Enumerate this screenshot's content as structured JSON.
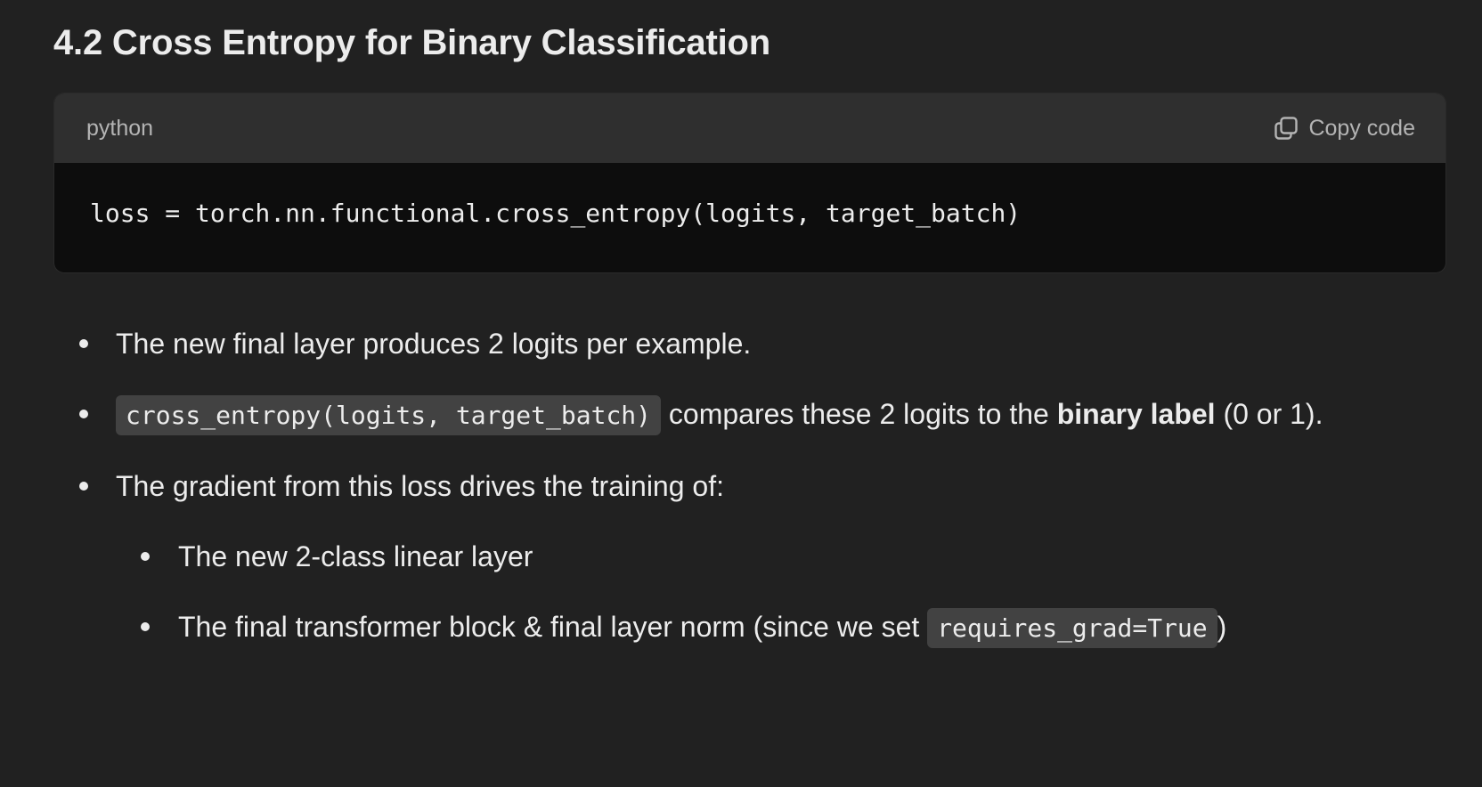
{
  "section": {
    "heading": "4.2 Cross Entropy for Binary Classification"
  },
  "code_block": {
    "language": "python",
    "copy_label": "Copy code",
    "copy_icon": "copy-icon",
    "code": "loss = torch.nn.functional.cross_entropy(logits, target_batch)"
  },
  "bullets": {
    "item1": "The new final layer produces 2 logits per example.",
    "item2_code": "cross_entropy(logits, target_batch)",
    "item2_text_a": " compares these 2 logits to the ",
    "item2_bold": "binary label",
    "item2_text_b": " (0 or 1).",
    "item3": "The gradient from this loss drives the training of:",
    "sub1": "The new 2-class linear layer",
    "sub2_text_a": "The final transformer block & final layer norm (since we set ",
    "sub2_code": "requires_grad=True",
    "sub2_text_b": ")"
  }
}
